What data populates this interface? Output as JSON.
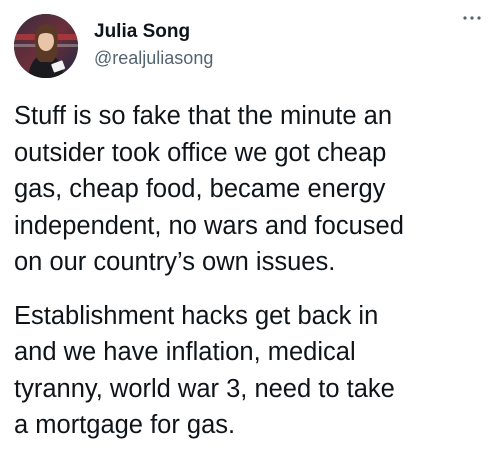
{
  "tweet": {
    "display_name": "Julia Song",
    "handle": "@realjuliasong",
    "avatar_icon": "profile-photo",
    "more_icon": "more-horizontal-icon",
    "paragraphs": [
      {
        "lines": [
          "Stuff is so fake that the minute an",
          "outsider took office we got cheap",
          "gas, cheap food, became energy",
          "independent, no wars and focused",
          "on our country’s own issues."
        ]
      },
      {
        "lines": [
          "Establishment hacks get back in",
          "and we have inflation, medical",
          "tyranny, world war 3, need to take",
          "a mortgage for gas."
        ]
      }
    ]
  },
  "colors": {
    "text_primary": "#0f1419",
    "text_secondary": "#536471",
    "background": "#ffffff"
  }
}
